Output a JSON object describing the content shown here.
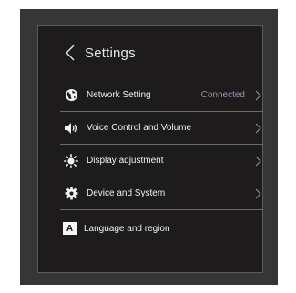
{
  "header": {
    "title": "Settings",
    "back_icon": "chevron-left-icon"
  },
  "rows": [
    {
      "label": "Network Setting",
      "status": "Connected",
      "icon": "globe-icon"
    },
    {
      "label": "Voice Control and Volume",
      "status": "",
      "icon": "speaker-icon"
    },
    {
      "label": "Display adjustment",
      "status": "",
      "icon": "sun-icon"
    },
    {
      "label": "Device and System",
      "status": "",
      "icon": "gear-icon"
    },
    {
      "label": "Language and region",
      "status": "",
      "icon": "language-icon",
      "badge": "A"
    }
  ],
  "colors": {
    "screen_bg": "#1d1b1b",
    "frame_bg": "#363636",
    "text": "#f2f2f2",
    "status": "#9a8fb2"
  }
}
